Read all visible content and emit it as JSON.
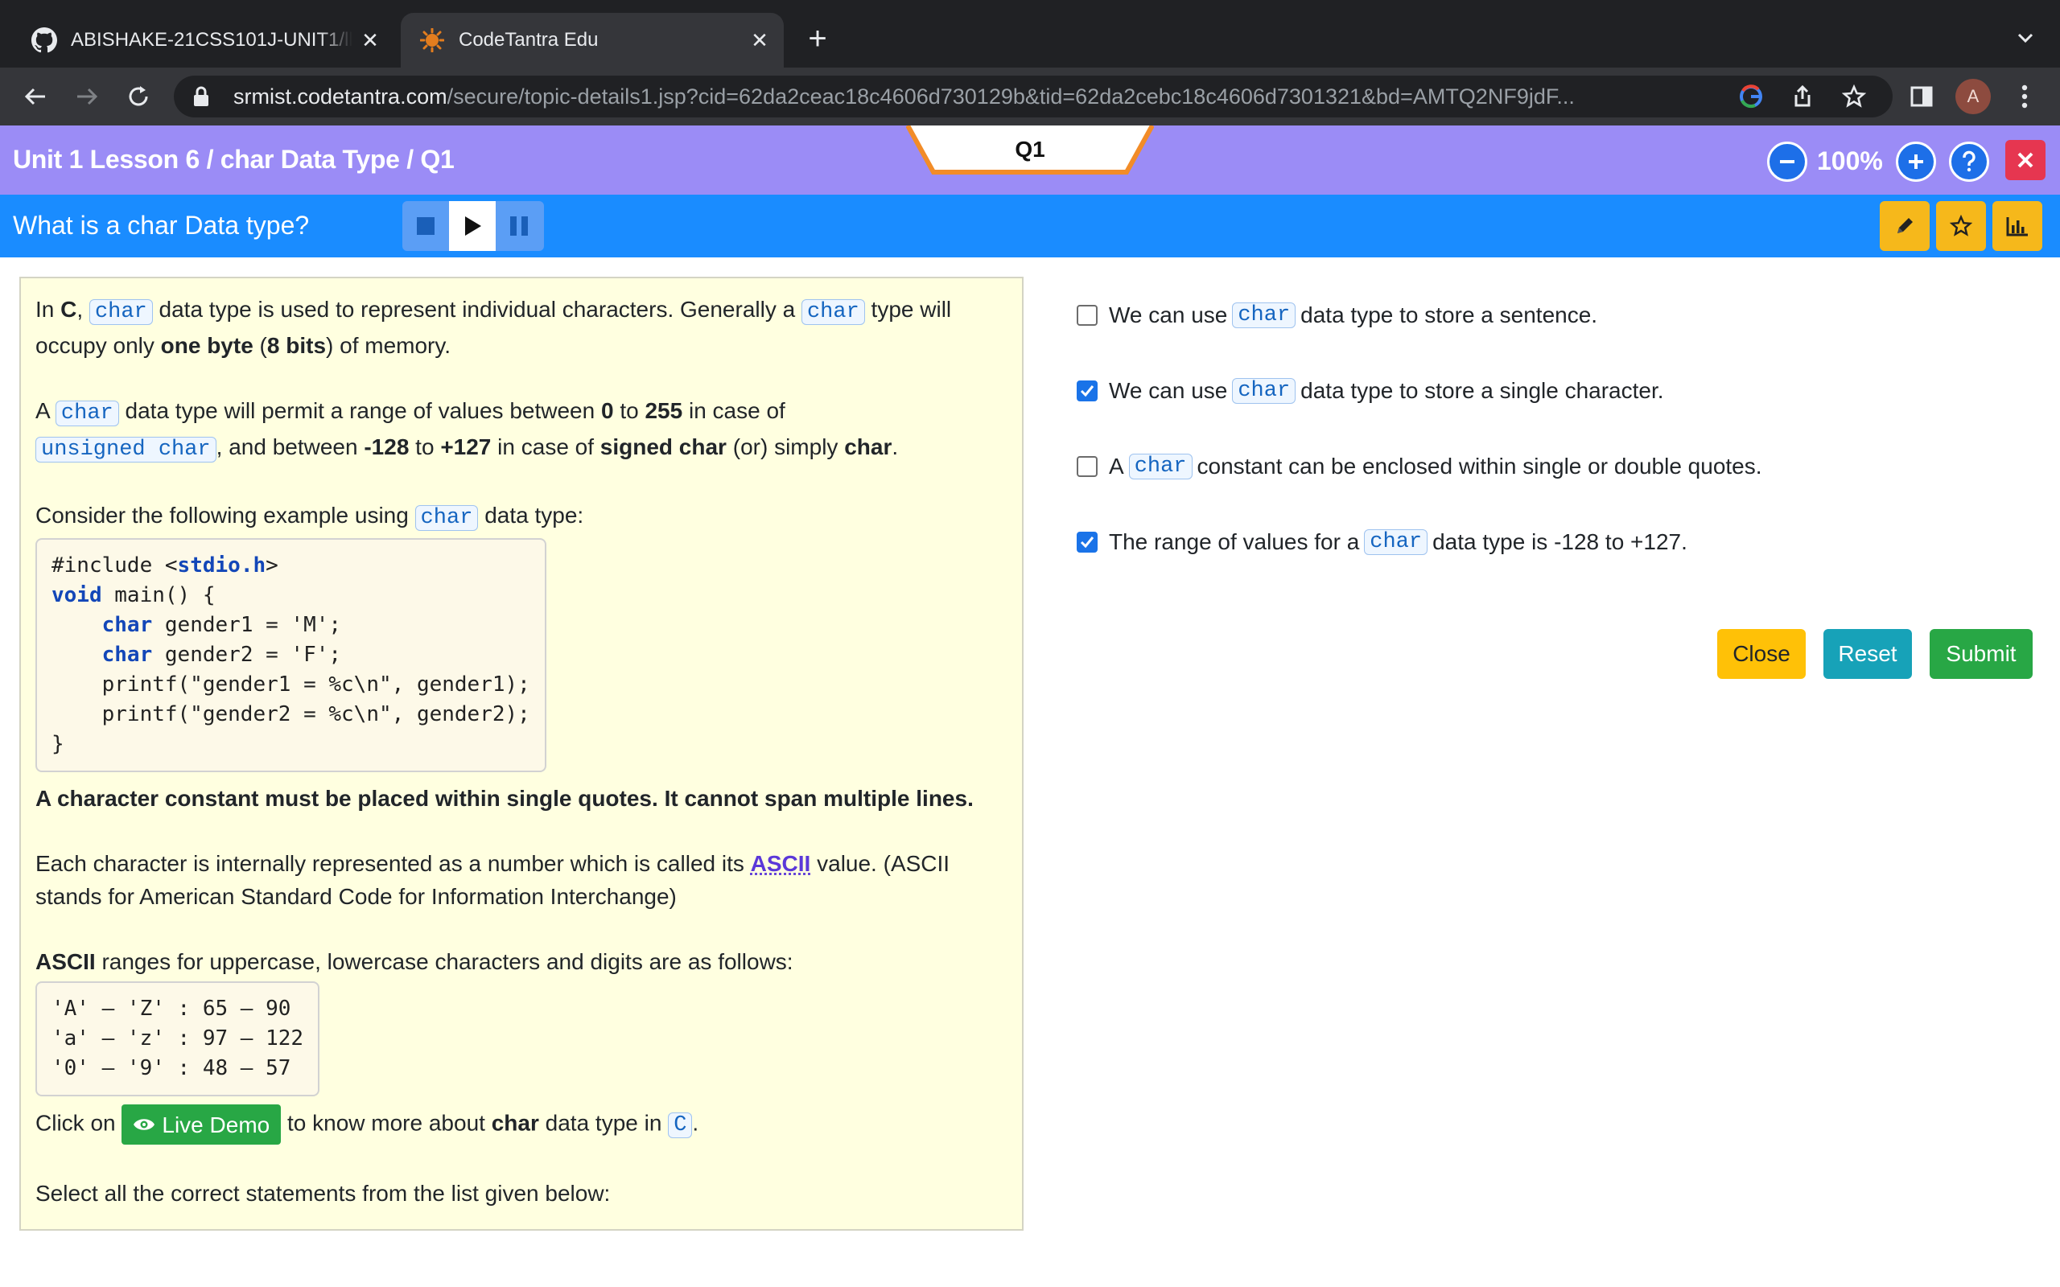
{
  "browser": {
    "tabs": [
      {
        "title": "ABISHAKE-21CSS101J-UNIT1/ll",
        "icon": "github-icon",
        "active": false
      },
      {
        "title": "CodeTantra Edu",
        "icon": "codetantra-icon",
        "active": true
      }
    ],
    "url_host": "srmist.codetantra.com",
    "url_path": "/secure/topic-details1.jsp?cid=62da2ceac18c4606d730129b&tid=62da2cebc18c4606d7301321&bd=AMTQ2NF9jdF...",
    "profile_initial": "A"
  },
  "header": {
    "breadcrumb": "Unit 1 Lesson 6 / char Data Type / Q1",
    "question_tab": "Q1",
    "zoom": "100%"
  },
  "question": {
    "title": "What is a char Data type?"
  },
  "content": {
    "p1": {
      "t1": "In ",
      "b1": "C",
      "t2": ", ",
      "c1": "char",
      "t3": " data type is used to represent individual characters. Generally a ",
      "c2": "char",
      "t4": " type will occupy only ",
      "b2": "one byte",
      "t5": " (",
      "b3": "8 bits",
      "t6": ") of memory."
    },
    "p2": {
      "t1": "A ",
      "c1": "char",
      "t2": " data type will permit a range of values between ",
      "b1": "0",
      "t3": " to ",
      "b2": "255",
      "t4": " in case of ",
      "c2": "unsigned char",
      "t5": ", and between ",
      "b3": "-128",
      "t6": " to ",
      "b4": "+127",
      "t7": " in case of ",
      "b5": "signed char",
      "t8": " (or) simply ",
      "b6": "char",
      "t9": "."
    },
    "p3": {
      "t1": "Consider the following example using ",
      "c1": "char",
      "t2": " data type:"
    },
    "code": {
      "l1a": "#include <",
      "l1b": "stdio.h",
      "l1c": ">",
      "l2a": "void",
      "l2b": " main() {",
      "l3a": "    ",
      "l3b": "char",
      "l3c": " gender1 = 'M';",
      "l4a": "    ",
      "l4b": "char",
      "l4c": " gender2 = 'F';",
      "l5": "    printf(\"gender1 = %c\\n\", gender1);",
      "l6": "    printf(\"gender2 = %c\\n\", gender2);",
      "l7": "}"
    },
    "p4": "A character constant must be placed within single quotes. It cannot span multiple lines.",
    "p5": {
      "t1": "Each character is internally represented as a number which is called its ",
      "link": "ASCII",
      "t2": " value. (ASCII stands for American Standard Code for Information Interchange)"
    },
    "p6": {
      "b1": "ASCII",
      "t1": " ranges for uppercase, lowercase characters and digits are as follows:"
    },
    "ascii": {
      "r1": "'A' – 'Z' : 65 – 90",
      "r2": "'a' – 'z' : 97 – 122",
      "r3": "'0' – '9' : 48 – 57"
    },
    "p7": {
      "t1": "Click on ",
      "btn": "Live Demo",
      "t2": " to know more about ",
      "b1": "char",
      "t3": " data type in ",
      "c1": "C",
      "t4": "."
    },
    "p8": "Select all the correct statements from the list given below:"
  },
  "options": [
    {
      "pre": "We can use ",
      "code": "char",
      "post": " data type to store a sentence.",
      "checked": false
    },
    {
      "pre": "We can use ",
      "code": "char",
      "post": " data type to store a single character.",
      "checked": true
    },
    {
      "pre": "A ",
      "code": "char",
      "post": " constant can be enclosed within single or double quotes.",
      "checked": false
    },
    {
      "pre": "The range of values for a ",
      "code": "char",
      "post": " data type is -128 to +127.",
      "checked": true
    }
  ],
  "actions": {
    "close": "Close",
    "reset": "Reset",
    "submit": "Submit"
  },
  "colors": {
    "header_purple": "#9b8cf6",
    "question_blue": "#1a8cff",
    "card_bg": "#ffffe0",
    "close_yellow": "#ffc107",
    "reset_teal": "#17a2b8",
    "submit_green": "#28a745",
    "exit_red": "#e63650"
  }
}
